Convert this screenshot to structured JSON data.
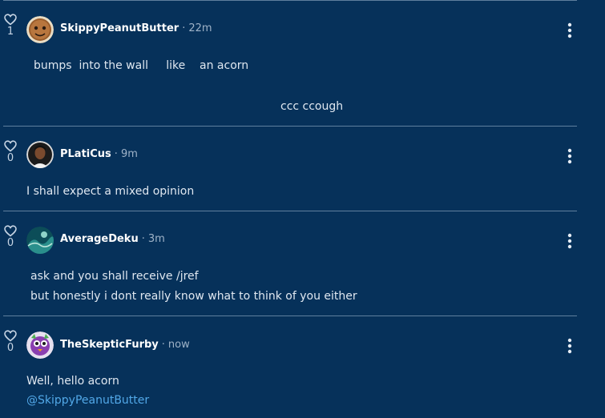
{
  "comments": [
    {
      "username": "SkippyPeanutButter",
      "time": "22m",
      "likes": "1",
      "avatar_icon": "peanut-butter-avatar",
      "lines": [
        "bumps  into the wall     like    an acorn",
        "ccc ccough"
      ]
    },
    {
      "username": "PLatiCus",
      "time": "9m",
      "likes": "0",
      "avatar_icon": "portrait-avatar",
      "lines": [
        "I shall expect a mixed opinion"
      ]
    },
    {
      "username": "AverageDeku",
      "time": "3m",
      "likes": "0",
      "avatar_icon": "wave-avatar",
      "lines": [
        "ask and you shall receive /jref",
        "but honestly i dont really know what to think of you either"
      ]
    },
    {
      "username": "TheSkepticFurby",
      "time": "now",
      "likes": "0",
      "avatar_icon": "furby-avatar",
      "lines": [
        "Well, hello acorn"
      ],
      "mention": "@SkippyPeanutButter"
    }
  ],
  "separator": "·",
  "colors": {
    "background": "#06315a",
    "divider": "#5f7f9e",
    "mention": "#52a8e8"
  }
}
